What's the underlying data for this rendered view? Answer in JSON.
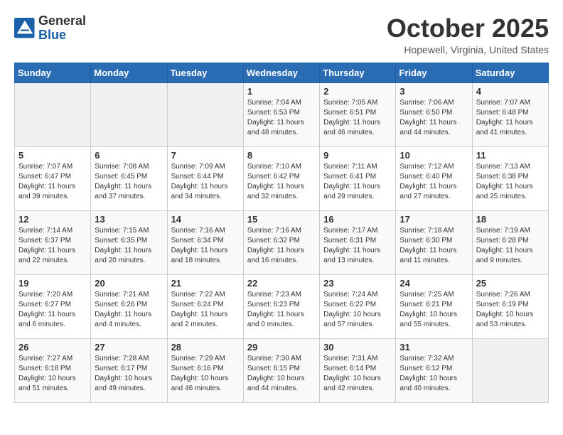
{
  "logo": {
    "general": "General",
    "blue": "Blue"
  },
  "title": "October 2025",
  "location": "Hopewell, Virginia, United States",
  "days_of_week": [
    "Sunday",
    "Monday",
    "Tuesday",
    "Wednesday",
    "Thursday",
    "Friday",
    "Saturday"
  ],
  "weeks": [
    [
      {
        "day": "",
        "info": ""
      },
      {
        "day": "",
        "info": ""
      },
      {
        "day": "",
        "info": ""
      },
      {
        "day": "1",
        "info": "Sunrise: 7:04 AM\nSunset: 6:53 PM\nDaylight: 11 hours\nand 48 minutes."
      },
      {
        "day": "2",
        "info": "Sunrise: 7:05 AM\nSunset: 6:51 PM\nDaylight: 11 hours\nand 46 minutes."
      },
      {
        "day": "3",
        "info": "Sunrise: 7:06 AM\nSunset: 6:50 PM\nDaylight: 11 hours\nand 44 minutes."
      },
      {
        "day": "4",
        "info": "Sunrise: 7:07 AM\nSunset: 6:48 PM\nDaylight: 11 hours\nand 41 minutes."
      }
    ],
    [
      {
        "day": "5",
        "info": "Sunrise: 7:07 AM\nSunset: 6:47 PM\nDaylight: 11 hours\nand 39 minutes."
      },
      {
        "day": "6",
        "info": "Sunrise: 7:08 AM\nSunset: 6:45 PM\nDaylight: 11 hours\nand 37 minutes."
      },
      {
        "day": "7",
        "info": "Sunrise: 7:09 AM\nSunset: 6:44 PM\nDaylight: 11 hours\nand 34 minutes."
      },
      {
        "day": "8",
        "info": "Sunrise: 7:10 AM\nSunset: 6:42 PM\nDaylight: 11 hours\nand 32 minutes."
      },
      {
        "day": "9",
        "info": "Sunrise: 7:11 AM\nSunset: 6:41 PM\nDaylight: 11 hours\nand 29 minutes."
      },
      {
        "day": "10",
        "info": "Sunrise: 7:12 AM\nSunset: 6:40 PM\nDaylight: 11 hours\nand 27 minutes."
      },
      {
        "day": "11",
        "info": "Sunrise: 7:13 AM\nSunset: 6:38 PM\nDaylight: 11 hours\nand 25 minutes."
      }
    ],
    [
      {
        "day": "12",
        "info": "Sunrise: 7:14 AM\nSunset: 6:37 PM\nDaylight: 11 hours\nand 22 minutes."
      },
      {
        "day": "13",
        "info": "Sunrise: 7:15 AM\nSunset: 6:35 PM\nDaylight: 11 hours\nand 20 minutes."
      },
      {
        "day": "14",
        "info": "Sunrise: 7:16 AM\nSunset: 6:34 PM\nDaylight: 11 hours\nand 18 minutes."
      },
      {
        "day": "15",
        "info": "Sunrise: 7:16 AM\nSunset: 6:32 PM\nDaylight: 11 hours\nand 16 minutes."
      },
      {
        "day": "16",
        "info": "Sunrise: 7:17 AM\nSunset: 6:31 PM\nDaylight: 11 hours\nand 13 minutes."
      },
      {
        "day": "17",
        "info": "Sunrise: 7:18 AM\nSunset: 6:30 PM\nDaylight: 11 hours\nand 11 minutes."
      },
      {
        "day": "18",
        "info": "Sunrise: 7:19 AM\nSunset: 6:28 PM\nDaylight: 11 hours\nand 9 minutes."
      }
    ],
    [
      {
        "day": "19",
        "info": "Sunrise: 7:20 AM\nSunset: 6:27 PM\nDaylight: 11 hours\nand 6 minutes."
      },
      {
        "day": "20",
        "info": "Sunrise: 7:21 AM\nSunset: 6:26 PM\nDaylight: 11 hours\nand 4 minutes."
      },
      {
        "day": "21",
        "info": "Sunrise: 7:22 AM\nSunset: 6:24 PM\nDaylight: 11 hours\nand 2 minutes."
      },
      {
        "day": "22",
        "info": "Sunrise: 7:23 AM\nSunset: 6:23 PM\nDaylight: 11 hours\nand 0 minutes."
      },
      {
        "day": "23",
        "info": "Sunrise: 7:24 AM\nSunset: 6:22 PM\nDaylight: 10 hours\nand 57 minutes."
      },
      {
        "day": "24",
        "info": "Sunrise: 7:25 AM\nSunset: 6:21 PM\nDaylight: 10 hours\nand 55 minutes."
      },
      {
        "day": "25",
        "info": "Sunrise: 7:26 AM\nSunset: 6:19 PM\nDaylight: 10 hours\nand 53 minutes."
      }
    ],
    [
      {
        "day": "26",
        "info": "Sunrise: 7:27 AM\nSunset: 6:18 PM\nDaylight: 10 hours\nand 51 minutes."
      },
      {
        "day": "27",
        "info": "Sunrise: 7:28 AM\nSunset: 6:17 PM\nDaylight: 10 hours\nand 49 minutes."
      },
      {
        "day": "28",
        "info": "Sunrise: 7:29 AM\nSunset: 6:16 PM\nDaylight: 10 hours\nand 46 minutes."
      },
      {
        "day": "29",
        "info": "Sunrise: 7:30 AM\nSunset: 6:15 PM\nDaylight: 10 hours\nand 44 minutes."
      },
      {
        "day": "30",
        "info": "Sunrise: 7:31 AM\nSunset: 6:14 PM\nDaylight: 10 hours\nand 42 minutes."
      },
      {
        "day": "31",
        "info": "Sunrise: 7:32 AM\nSunset: 6:12 PM\nDaylight: 10 hours\nand 40 minutes."
      },
      {
        "day": "",
        "info": ""
      }
    ]
  ]
}
